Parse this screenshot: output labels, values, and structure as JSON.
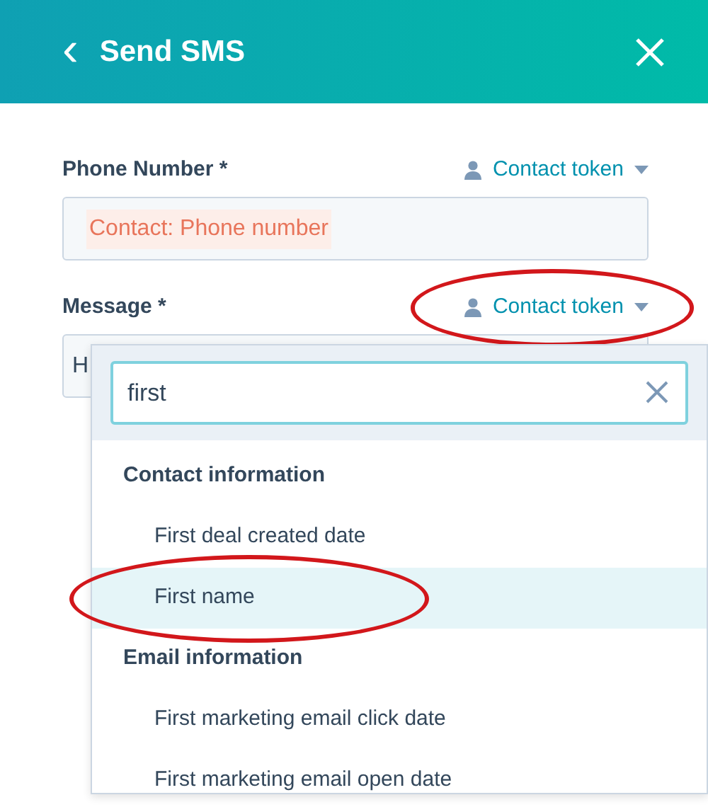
{
  "header": {
    "back_icon": "‹",
    "title": "Send SMS"
  },
  "fields": [
    {
      "label": "Phone Number *",
      "token_link": {
        "text": "Contact token"
      },
      "token_value": "Contact: Phone number"
    },
    {
      "label": "Message *",
      "token_link": {
        "text": "Contact token",
        "circled": true
      },
      "value": "H"
    }
  ],
  "dropdown": {
    "search_value": "first",
    "groups": [
      {
        "heading": "Contact information",
        "items": [
          {
            "label": "First deal created date",
            "selected": false,
            "circled": false
          },
          {
            "label": "First name",
            "selected": true,
            "circled": true
          }
        ]
      },
      {
        "heading": "Email information",
        "items": [
          {
            "label": "First marketing email click date",
            "selected": false,
            "circled": false
          },
          {
            "label": "First marketing email open date",
            "selected": false,
            "circled": false
          }
        ]
      }
    ]
  }
}
